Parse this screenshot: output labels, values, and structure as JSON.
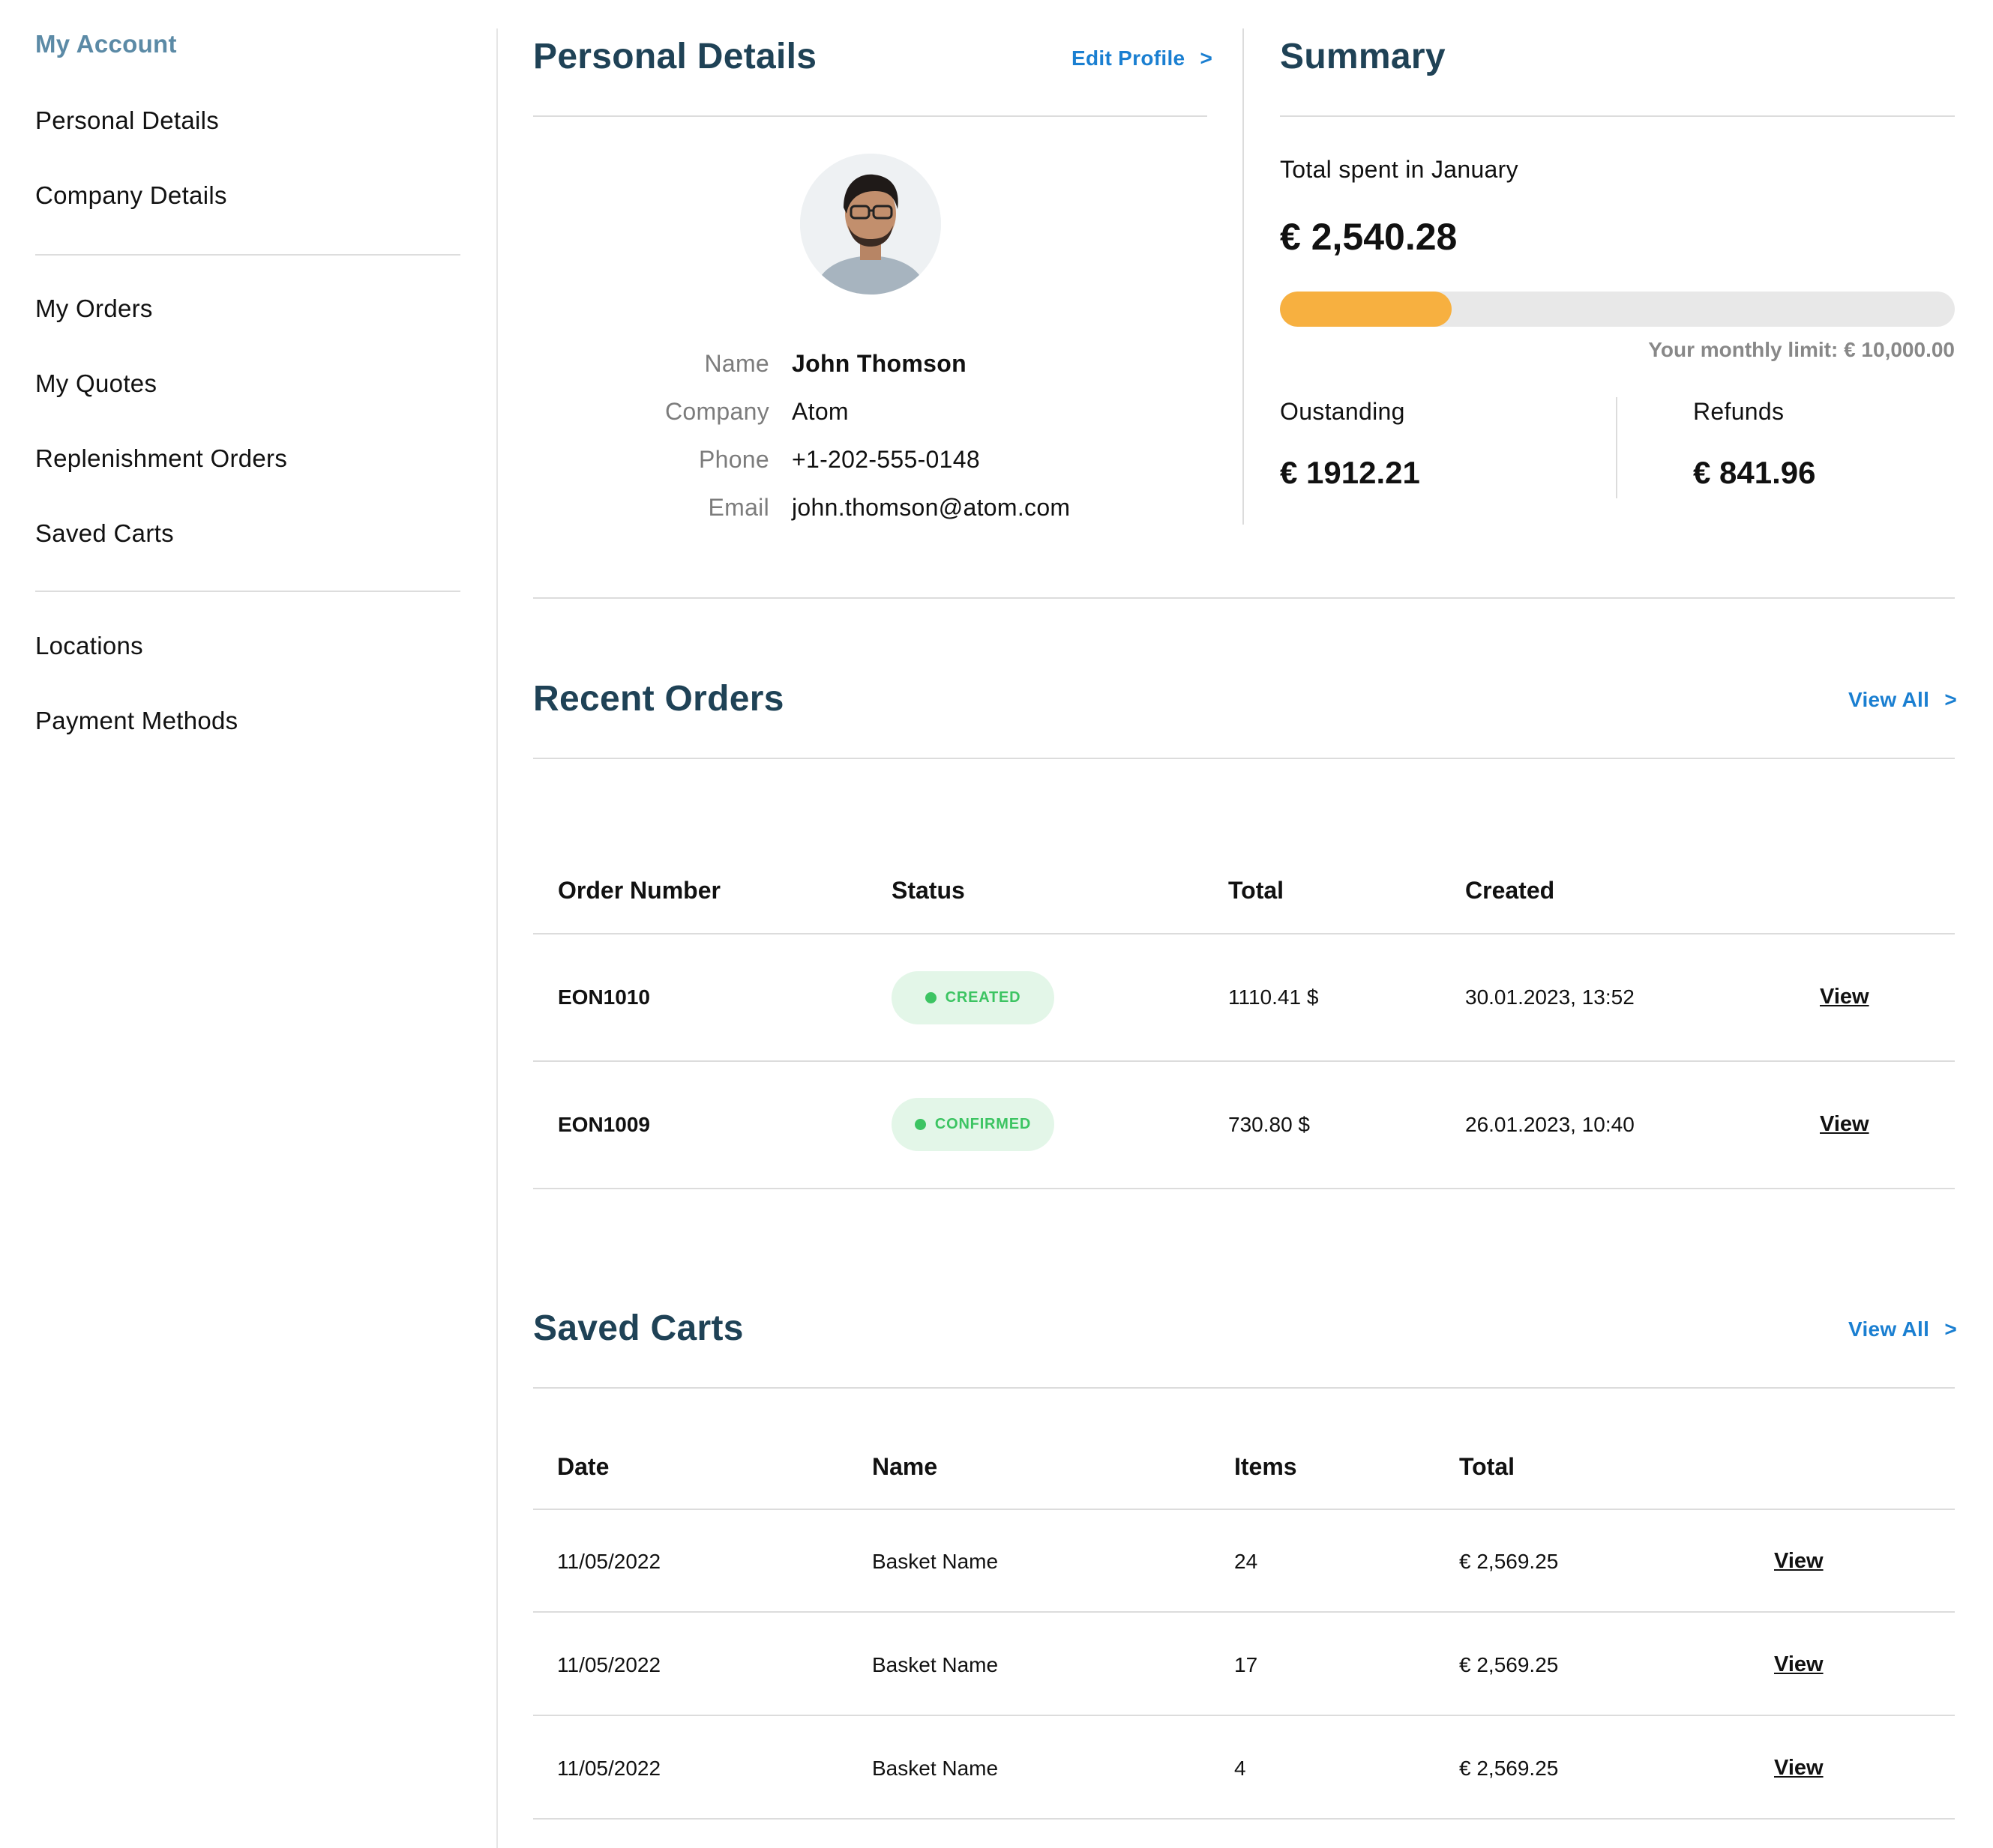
{
  "sidebar": {
    "title": "My Account",
    "group1": [
      "Personal Details",
      "Company Details"
    ],
    "group2": [
      "My Orders",
      "My Quotes",
      "Replenishment Orders",
      "Saved Carts"
    ],
    "group3": [
      "Locations",
      "Payment Methods"
    ]
  },
  "personal": {
    "title": "Personal Details",
    "edit_label": "Edit Profile",
    "name_label": "Name",
    "name_value": "John Thomson",
    "company_label": "Company",
    "company_value": "Atom",
    "phone_label": "Phone",
    "phone_value": "+1-202-555-0148",
    "email_label": "Email",
    "email_value": "john.thomson@atom.com"
  },
  "summary": {
    "title": "Summary",
    "spent_label": "Total spent in January",
    "spent_value": "€ 2,540.28",
    "progress_fraction": 0.254,
    "limit_text": "Your monthly limit: € 10,000.00",
    "outstanding_label": "Oustanding",
    "outstanding_value": "€ 1912.21",
    "refunds_label": "Refunds",
    "refunds_value": "€ 841.96",
    "accent_color": "#f7b040"
  },
  "orders": {
    "title": "Recent Orders",
    "view_all": "View All",
    "headers": [
      "Order Number",
      "Status",
      "Total",
      "Created"
    ],
    "rows": [
      {
        "number": "EON1010",
        "status": "CREATED",
        "total": "1110.41 $",
        "created": "30.01.2023, 13:52",
        "action": "View"
      },
      {
        "number": "EON1009",
        "status": "CONFIRMED",
        "total": "730.80 $",
        "created": "26.01.2023, 10:40",
        "action": "View"
      }
    ]
  },
  "carts": {
    "title": "Saved Carts",
    "view_all": "View All",
    "headers": [
      "Date",
      "Name",
      "Items",
      "Total"
    ],
    "rows": [
      {
        "date": "11/05/2022",
        "name": "Basket Name",
        "items": "24",
        "total": "€ 2,569.25",
        "action": "View"
      },
      {
        "date": "11/05/2022",
        "name": "Basket Name",
        "items": "17",
        "total": "€ 2,569.25",
        "action": "View"
      },
      {
        "date": "11/05/2022",
        "name": "Basket Name",
        "items": "4",
        "total": "€ 2,569.25",
        "action": "View"
      }
    ]
  },
  "chevron_glyph": ">"
}
